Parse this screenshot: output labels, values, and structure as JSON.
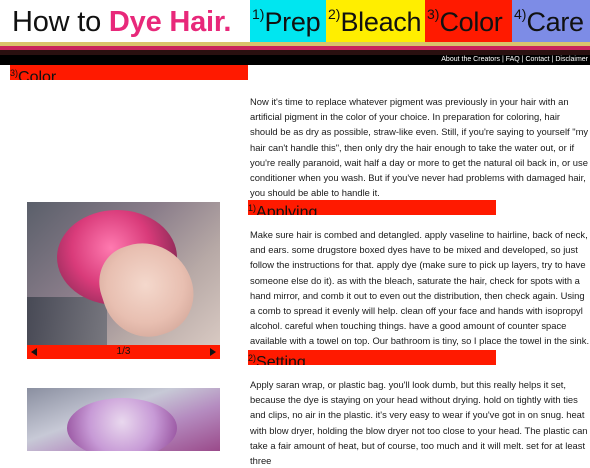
{
  "header": {
    "logo_prefix": "How to ",
    "logo_highlight": "Dye Hair.",
    "tabs": [
      {
        "num": "1)",
        "label": "Prep",
        "color": "#00e6f0"
      },
      {
        "num": "2)",
        "label": "Bleach",
        "color": "#ffee00"
      },
      {
        "num": "3)",
        "label": "Color",
        "color": "#ff1a00"
      },
      {
        "num": "4)",
        "label": "Care",
        "color": "#7d8ce6"
      }
    ],
    "links": [
      "About the Creators",
      "FAQ",
      "Contact",
      "Disclaimer"
    ],
    "link_sep": " | "
  },
  "section": {
    "num": "3)",
    "title": "Color",
    "intro": "Now it's time to replace whatever pigment was previously in your hair with an artificial pigment in the color of your choice. In preparation for coloring, hair should be as dry as possible, straw-like even. Still, if you're saying to yourself \"my hair can't handle this\", then only dry the hair enough to take the water out, or if you're really paranoid, wait half a day or more to get the natural oil back in, or use conditioner when you wash. But if you've never had problems with damaged hair, you should be able to handle it."
  },
  "subsections": [
    {
      "num": "1)",
      "title": "Applying",
      "body": "Make sure hair is combed and detangled. apply vaseline to hairline, back of neck, and ears. some drugstore boxed dyes have to be mixed and developed, so just follow the instructions for that. apply dye (make sure to pick up layers, try to have someone else do it). as with the bleach, saturate the hair, check for spots with a hand mirror, and comb it out to even out the distribution, then check again. Using a comb to spread it evenly will help. clean off your face and hands with isopropyl alcohol. careful when touching things. have a good amount of counter space available with a towel on top. Our bathroom is tiny, so I place the towel in the sink."
    },
    {
      "num": "2)",
      "title": "Setting",
      "body": "Apply saran wrap, or plastic bag. you'll look dumb, but this really helps it set, because the dye is staying on your head without drying. hold on tightly with ties and clips, no air in the plastic. it's very easy to wear if you've got in on snug. heat with blow dryer, holding the blow dryer not too close to your head. The plastic can take a fair amount of heat, but of course, too much and it will melt. set for at least three"
    }
  ],
  "gallery": {
    "counter": "1/3",
    "current": 1,
    "total": 3
  }
}
